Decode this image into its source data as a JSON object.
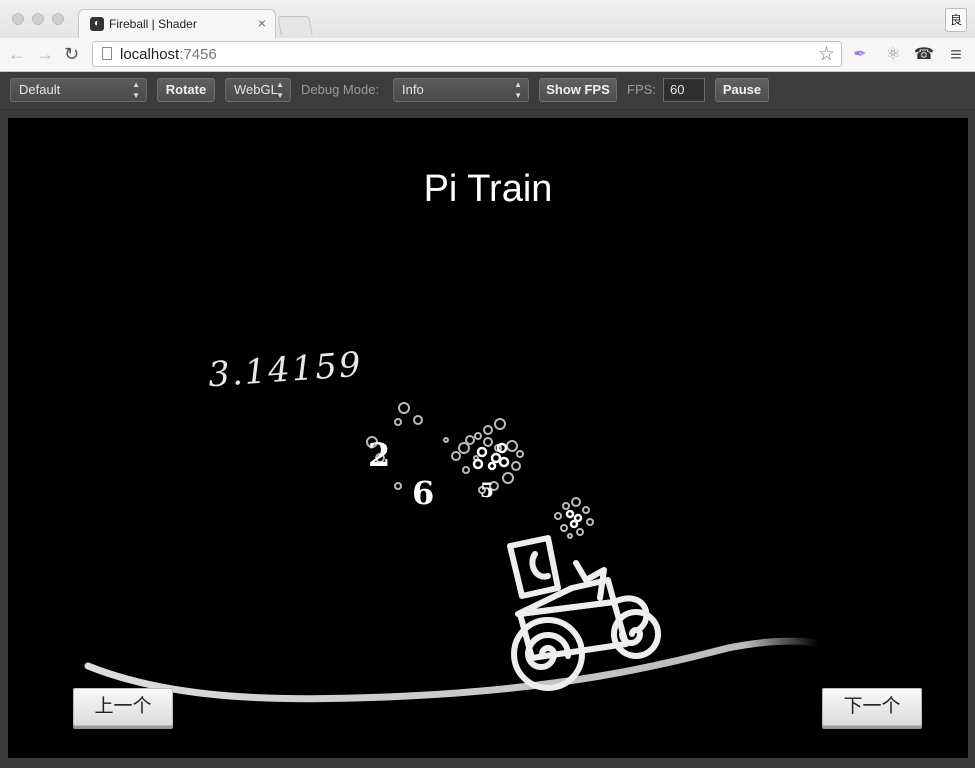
{
  "browser": {
    "tab_title": "Fireball | Shader",
    "tab_close": "×",
    "address_host": "localhost",
    "address_port": ":7456",
    "right_button": "良"
  },
  "controls": {
    "preset_select": "Default",
    "rotate_button": "Rotate",
    "renderer_select": "WebGL",
    "debug_label": "Debug Mode:",
    "debug_select": "Info",
    "show_fps_button": "Show FPS",
    "fps_label": "FPS:",
    "fps_value": "60",
    "pause_button": "Pause"
  },
  "scene": {
    "title": "Pi Train",
    "pi_digits": "3.14159",
    "digit_2": "2",
    "digit_6": "6",
    "digit_5": "5",
    "prev_button": "上一个",
    "next_button": "下一个"
  },
  "colors": {
    "canvas_bg": "#000000",
    "controls_bg": "#3c3c3c",
    "extension_feather": "#a77be6"
  },
  "icons": [
    "back-arrow-icon",
    "forward-arrow-icon",
    "reload-icon",
    "page-icon",
    "star-icon",
    "feather-icon",
    "atom-icon",
    "elephant-icon",
    "menu-icon"
  ]
}
